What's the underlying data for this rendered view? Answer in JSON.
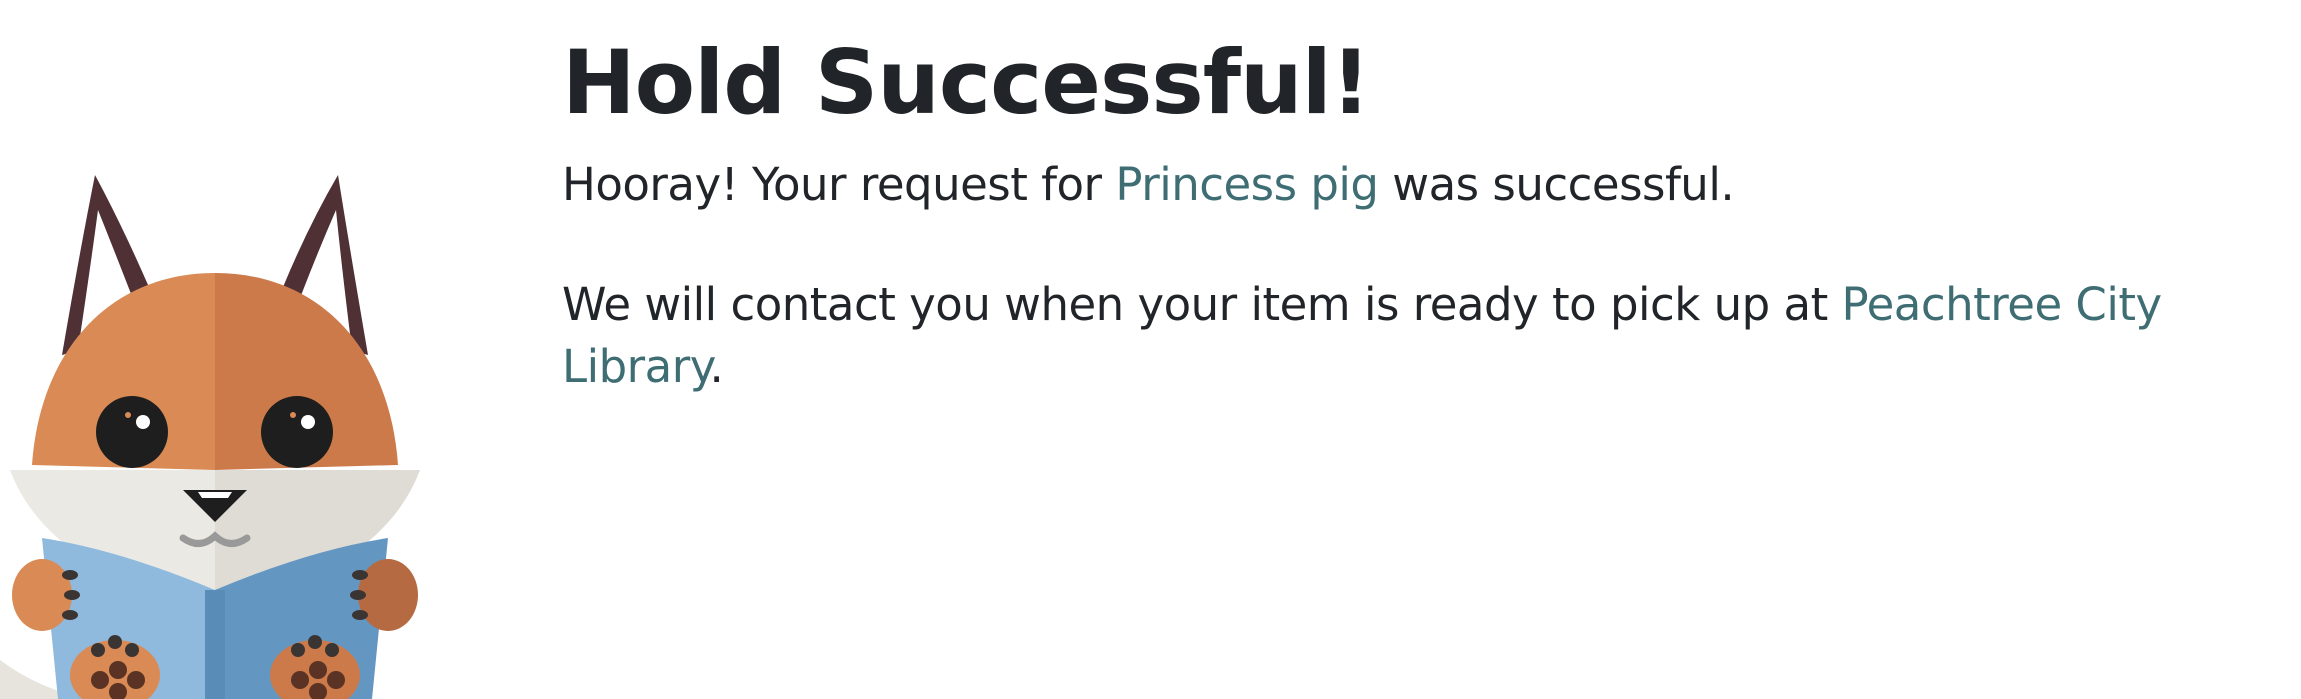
{
  "title": "Hold Successful!",
  "message1": {
    "prefix": "Hooray! Your request for ",
    "item_link": "Princess pig",
    "suffix": " was successful."
  },
  "message2": {
    "prefix": "We will contact you when your item is ready to pick up at ",
    "location_link": "Peachtree City Library",
    "suffix": "."
  },
  "colors": {
    "link": "#3e6d73",
    "text": "#212529",
    "fox_orange_light": "#d98a55",
    "fox_orange_dark": "#cc7a4a",
    "book_blue_light": "#8fbadd",
    "book_blue_dark": "#6496c2",
    "ear_dark": "#4f3035"
  },
  "icons": {
    "mascot": "fox-reading-book-illustration"
  }
}
